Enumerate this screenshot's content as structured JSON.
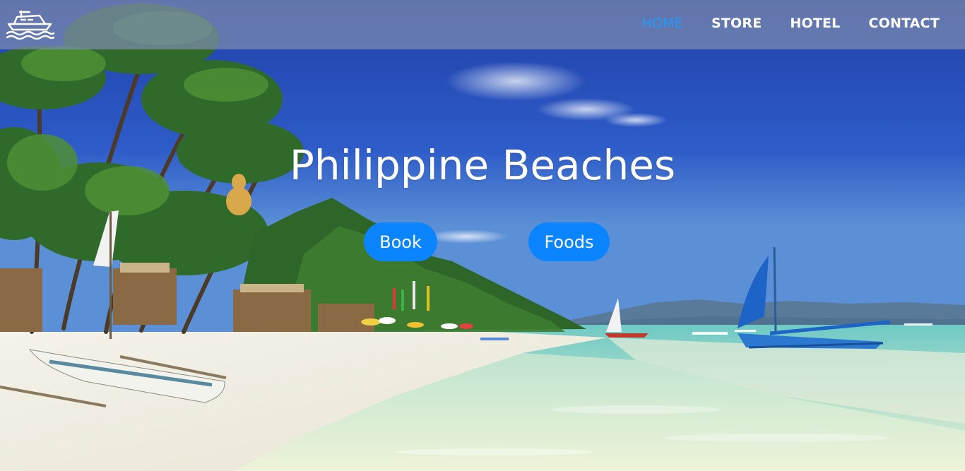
{
  "nav": {
    "logo_icon": "boat-on-waves-icon",
    "items": [
      {
        "label": "HOME",
        "active": true
      },
      {
        "label": "STORE",
        "active": false
      },
      {
        "label": "HOTEL",
        "active": false
      },
      {
        "label": "CONTACT",
        "active": false
      }
    ],
    "active_color": "#1e9bff"
  },
  "hero": {
    "title": "Philippine Beaches",
    "buttons": {
      "book": "Book",
      "foods": "Foods"
    },
    "button_color": "#0a84ff",
    "background_image": "tropical beach with palm trees, white sand, outrigger boats and clear turquoise water"
  }
}
